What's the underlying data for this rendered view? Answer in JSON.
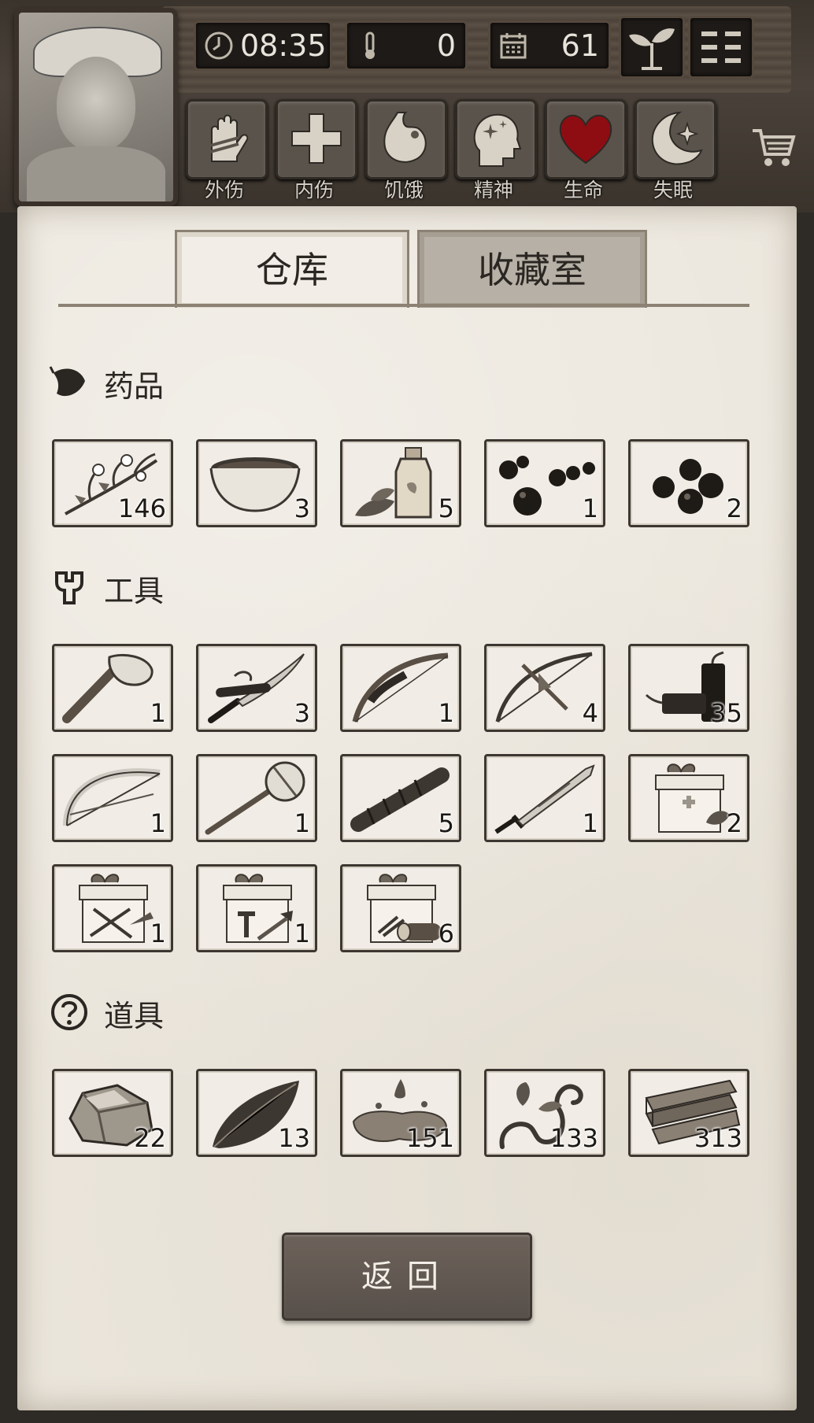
{
  "hud": {
    "time": "08:35",
    "temperature": "0",
    "day": "61"
  },
  "status": [
    {
      "label": "外伤",
      "icon": "hand-bandage-icon"
    },
    {
      "label": "内伤",
      "icon": "cross-icon"
    },
    {
      "label": "饥饿",
      "icon": "stomach-icon"
    },
    {
      "label": "精神",
      "icon": "head-sparkle-icon"
    },
    {
      "label": "生命",
      "icon": "heart-icon"
    },
    {
      "label": "失眠",
      "icon": "moon-icon"
    }
  ],
  "tabs": {
    "warehouse": "仓库",
    "collection": "收藏室"
  },
  "sections": {
    "medicine": {
      "title": "药品",
      "items": [
        {
          "icon": "herb-branch-icon",
          "count": "146"
        },
        {
          "icon": "bowl-icon",
          "count": "3"
        },
        {
          "icon": "potion-bottle-icon",
          "count": "5"
        },
        {
          "icon": "berries-icon",
          "count": "1"
        },
        {
          "icon": "dark-berries-icon",
          "count": "2"
        }
      ]
    },
    "tools": {
      "title": "工具",
      "items": [
        {
          "icon": "stone-axe-icon",
          "count": "1"
        },
        {
          "icon": "katana-icon",
          "count": "3"
        },
        {
          "icon": "bow-icon",
          "count": "1"
        },
        {
          "icon": "crossbow-icon",
          "count": "4"
        },
        {
          "icon": "dynamite-icon",
          "count": "35"
        },
        {
          "icon": "bone-bow-icon",
          "count": "1"
        },
        {
          "icon": "stone-hammer-icon",
          "count": "1"
        },
        {
          "icon": "handle-icon",
          "count": "5"
        },
        {
          "icon": "broad-sword-icon",
          "count": "1"
        },
        {
          "icon": "medical-gift-box-icon",
          "count": "2"
        },
        {
          "icon": "weapon-gift-box-icon",
          "count": "1"
        },
        {
          "icon": "tool-gift-box-icon",
          "count": "1"
        },
        {
          "icon": "wood-gift-box-icon",
          "count": "6"
        }
      ]
    },
    "props": {
      "title": "道具",
      "items": [
        {
          "icon": "rock-icon",
          "count": "22"
        },
        {
          "icon": "leaf-icon",
          "count": "13"
        },
        {
          "icon": "water-puddle-icon",
          "count": "151"
        },
        {
          "icon": "vine-icon",
          "count": "133"
        },
        {
          "icon": "planks-icon",
          "count": "313"
        }
      ]
    }
  },
  "back_button": "返回"
}
